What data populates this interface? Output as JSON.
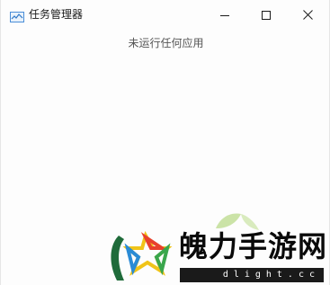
{
  "window": {
    "title": "任务管理器",
    "icon": "task-manager-icon",
    "controls": [
      "minimize-icon",
      "maximize-icon",
      "close-icon"
    ]
  },
  "main": {
    "empty_message": "未运行任何应用"
  },
  "watermark": {
    "text": "魄力手游网",
    "url": "dlight.cc"
  },
  "colors": {
    "background": "#fdfdfd",
    "title_text": "#1a1a1a",
    "message_text": "#555555"
  }
}
